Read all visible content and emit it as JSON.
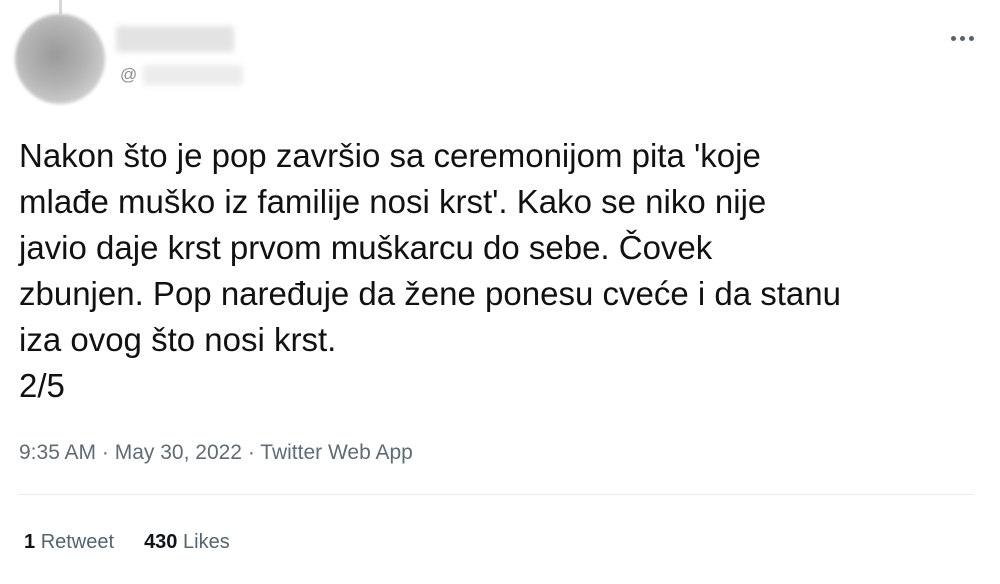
{
  "tweet": {
    "handle_prefix": "@",
    "text_lines": [
      "Nakon što je pop završio sa ceremonijom pita 'koje",
      "mlađe muško iz familije nosi krst'. Kako se niko nije",
      "javio daje krst prvom muškarcu do sebe. Čovek",
      "zbunjen. Pop naređuje da žene ponesu cveće i da stanu",
      "iza ovog što nosi krst.",
      "2/5"
    ],
    "time": "9:35 AM",
    "separator": " · ",
    "date": "May 30, 2022",
    "source": "Twitter Web App",
    "stats": {
      "retweets_count": "1",
      "retweets_label": "Retweet",
      "likes_count": "430",
      "likes_label": "Likes"
    }
  },
  "icons": {
    "more": "more-horizontal-icon"
  },
  "colors": {
    "text": "#0f1419",
    "secondary": "#536471",
    "divider": "#e6ecf0"
  }
}
